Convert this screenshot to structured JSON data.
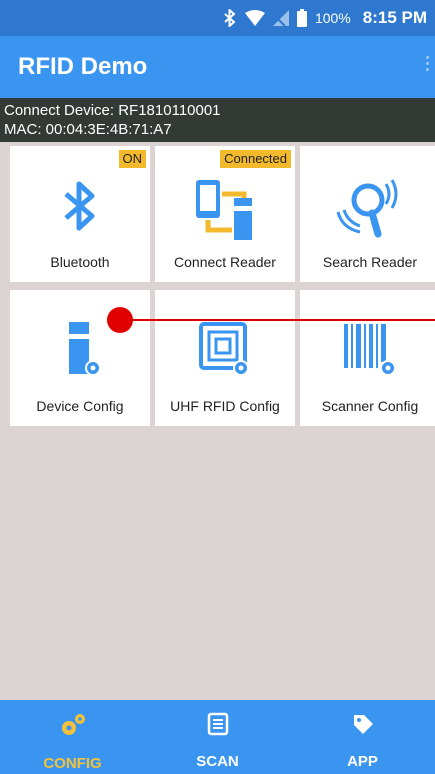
{
  "status_bar": {
    "battery_percent": "100%",
    "time": "8:15 PM",
    "icons": [
      "bluetooth-icon",
      "wifi-icon",
      "no-signal-icon",
      "battery-icon"
    ]
  },
  "app_bar": {
    "title": "RFID Demo"
  },
  "device_info": {
    "connect_line": "Connect Device: RF1810110001",
    "mac_line": "MAC: 00:04:3E:4B:71:A7"
  },
  "tiles": [
    {
      "label": "Bluetooth",
      "badge": "ON",
      "icon": "bluetooth-icon"
    },
    {
      "label": "Connect Reader",
      "badge": "Connected",
      "icon": "connect-reader-icon"
    },
    {
      "label": "Search Reader",
      "badge": "",
      "icon": "search-reader-icon"
    },
    {
      "label": "Device Config",
      "badge": "",
      "icon": "device-config-icon"
    },
    {
      "label": "UHF RFID Config",
      "badge": "",
      "icon": "rfid-config-icon"
    },
    {
      "label": "Scanner Config",
      "badge": "",
      "icon": "scanner-config-icon"
    }
  ],
  "bottom_nav": [
    {
      "label": "CONFIG",
      "icon": "gears-icon",
      "active": true
    },
    {
      "label": "SCAN",
      "icon": "list-icon",
      "active": false
    },
    {
      "label": "APP",
      "icon": "app-tag-icon",
      "active": false
    }
  ],
  "colors": {
    "status_bar": "#2f78d0",
    "app_bar": "#3a95f0",
    "info_bar": "#333a36",
    "badge": "#f2b92c",
    "accent_active": "#f3c23a",
    "icon_blue": "#3a95f0",
    "background": "#dcd3d3",
    "pointer": "#e00000"
  }
}
